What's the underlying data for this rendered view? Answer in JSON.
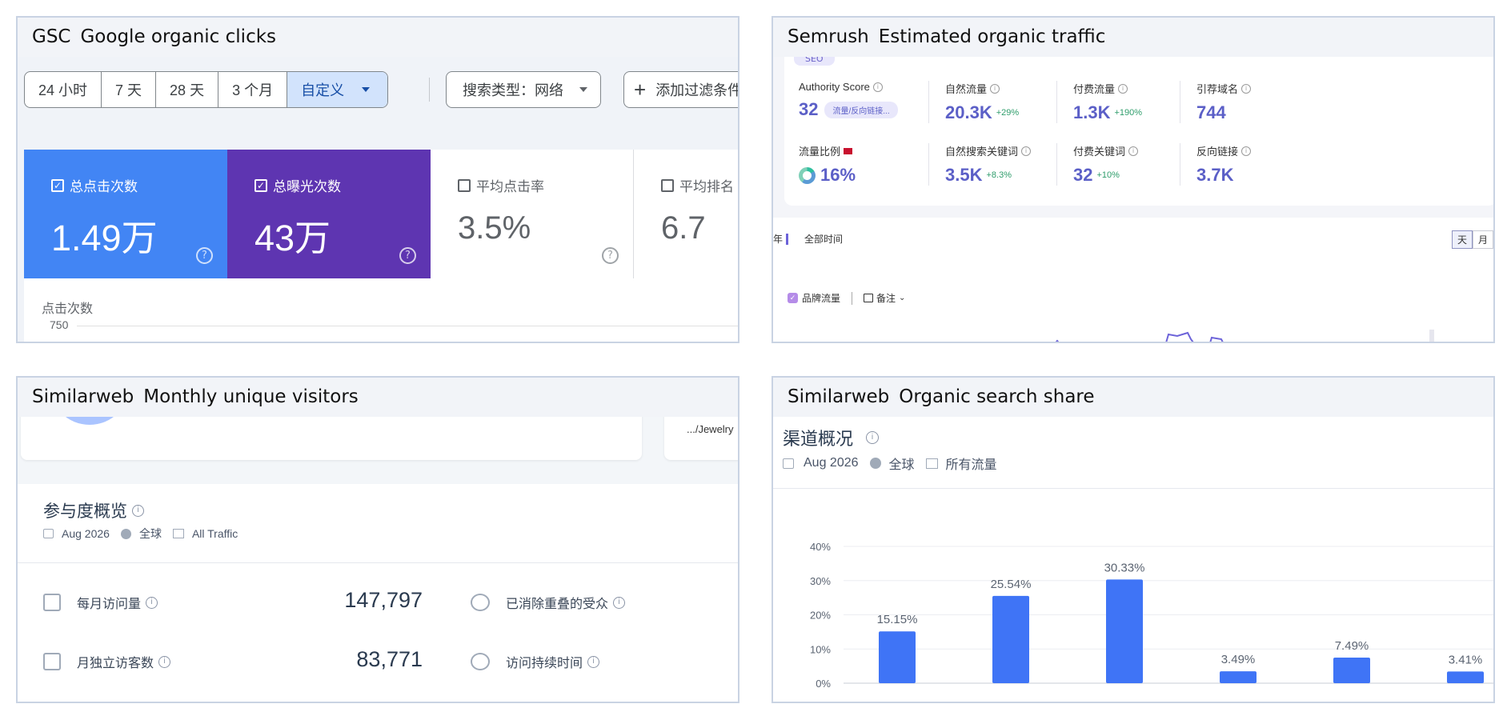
{
  "panels": {
    "gsc": {
      "source": "GSC",
      "title": "Google organic clicks"
    },
    "semrush": {
      "source": "Semrush",
      "title": "Estimated organic traffic"
    },
    "sw_visitors": {
      "source": "Similarweb",
      "title": "Monthly unique visitors"
    },
    "sw_share": {
      "source": "Similarweb",
      "title": "Organic search share"
    }
  },
  "gsc": {
    "ranges": [
      "24 小时",
      "7 天",
      "28 天",
      "3 个月"
    ],
    "custom": "自定义",
    "search_type": "搜索类型：网络",
    "add_filter": "添加过滤条件",
    "cards": {
      "clicks": {
        "label": "总点击次数",
        "value": "1.49万"
      },
      "impressions": {
        "label": "总曝光次数",
        "value": "43万"
      },
      "ctr": {
        "label": "平均点击率",
        "value": "3.5%"
      },
      "position": {
        "label": "平均排名",
        "value": "6.7"
      }
    },
    "chart": {
      "ylabel": "点击次数",
      "tick": "750"
    },
    "colors": {
      "clicks": "#4285f4",
      "impressions": "#5e35b1"
    }
  },
  "semrush": {
    "seo_tag": "SEO",
    "metrics": {
      "authority": {
        "label": "Authority Score",
        "value": "32",
        "badge": "流量/反向链接..."
      },
      "organic": {
        "label": "自然流量",
        "value": "20.3K",
        "delta": "+29%"
      },
      "paid": {
        "label": "付费流量",
        "value": "1.3K",
        "delta": "+190%"
      },
      "ref_domains": {
        "label": "引荐域名",
        "value": "744"
      },
      "traffic_share": {
        "label": "流量比例",
        "value": "16%"
      },
      "organic_kw": {
        "label": "自然搜索关键词",
        "value": "3.5K",
        "delta": "+8.3%"
      },
      "paid_kw": {
        "label": "付费关键词",
        "value": "32",
        "delta": "+10%"
      },
      "backlinks": {
        "label": "反向链接",
        "value": "3.7K"
      }
    },
    "tab_cut": "年",
    "tab_all": "全部时间",
    "toggle": [
      "天",
      "月"
    ],
    "legend_brand": "品牌流量",
    "legend_note": "备注"
  },
  "sw_visitors": {
    "top_snippet": ".../Jewelry",
    "title": "参与度概览",
    "meta": {
      "date": "Aug 2026",
      "region": "全球",
      "traffic": "All Traffic"
    },
    "rows": [
      {
        "label": "每月访问量",
        "value": "147,797"
      },
      {
        "label": "月独立访客数",
        "value": "83,771"
      }
    ],
    "rows_right": [
      {
        "label": "已消除重叠的受众"
      },
      {
        "label": "访问持续时间"
      }
    ]
  },
  "sw_share": {
    "title": "渠道概况",
    "meta": {
      "date": "Aug 2026",
      "region": "全球",
      "traffic": "所有流量"
    }
  },
  "chart_data": {
    "type": "bar",
    "title": "",
    "xlabel": "",
    "ylabel": "",
    "y_ticks": [
      "0%",
      "10%",
      "20%",
      "30%",
      "40%"
    ],
    "ylim": [
      0,
      40
    ],
    "values": [
      15.15,
      25.54,
      30.33,
      3.49,
      7.49,
      3.41
    ],
    "labels": [
      "15.15%",
      "25.54%",
      "30.33%",
      "3.49%",
      "7.49%",
      "3.41%"
    ],
    "color": "#3f74f6",
    "grid": true
  }
}
